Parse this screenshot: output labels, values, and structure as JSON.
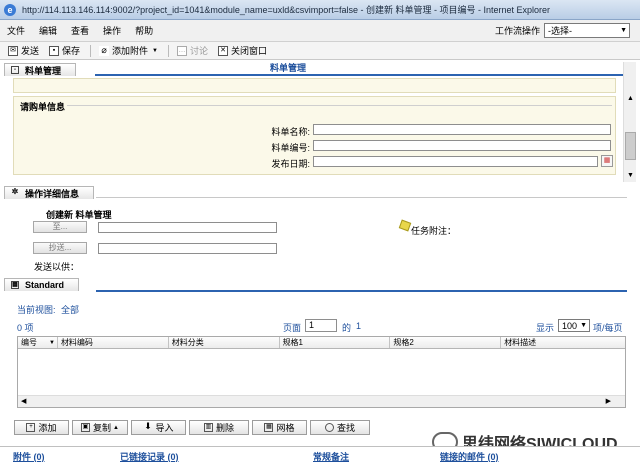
{
  "window": {
    "title": "http://114.113.146.114:9002/?project_id=1041&module_name=uxld&csvimport=false - 创建新 料单管理 - 项目编号 - Internet Explorer"
  },
  "menu": {
    "items": [
      "文件",
      "编辑",
      "查看",
      "操作",
      "帮助"
    ],
    "workflow_label": "工作流操作",
    "workflow_select": "-选择-"
  },
  "toolbar": {
    "send": "发送",
    "save": "保存",
    "attach": "添加附件",
    "discuss": "讨论",
    "close": "关闭窗口"
  },
  "section_material": {
    "tab_label": "料单管理",
    "center_title": "料单管理",
    "fieldset_label": "请购单信息",
    "name_label": "料单名称:",
    "code_label": "料单编号:",
    "date_label": "发布日期:"
  },
  "section_ops": {
    "tab_label": "操作详细信息",
    "subtitle": "创建新 料单管理",
    "to_button": "至...",
    "cc_button": "抄送...",
    "send_as_label": "发送以供：",
    "task_note_label": "任务附注："
  },
  "section_standard": {
    "tab_label": "Standard",
    "current_view_label": "当前视图:",
    "current_view_value": "全部",
    "count": "0 项",
    "page_label": "页面",
    "page_value": "1",
    "of_label": "的",
    "total_pages": "1",
    "display_label": "显示",
    "per_page": "100",
    "per_page_suffix": "项/每页",
    "columns": [
      "编号",
      "材料编码",
      "材料分类",
      "规格1",
      "规格2",
      "材料描述"
    ]
  },
  "actions": {
    "add": "添加",
    "copy": "复制",
    "import": "导入",
    "delete": "删除",
    "grid": "网格",
    "search": "查找"
  },
  "footer": {
    "attachments": "附件 (0)",
    "linked_records": "已链接记录 (0)",
    "notes": "常规备注",
    "linked_mail": "链接的邮件 (0)"
  },
  "watermark": {
    "text": "思纬网络SIWICLOUD"
  }
}
